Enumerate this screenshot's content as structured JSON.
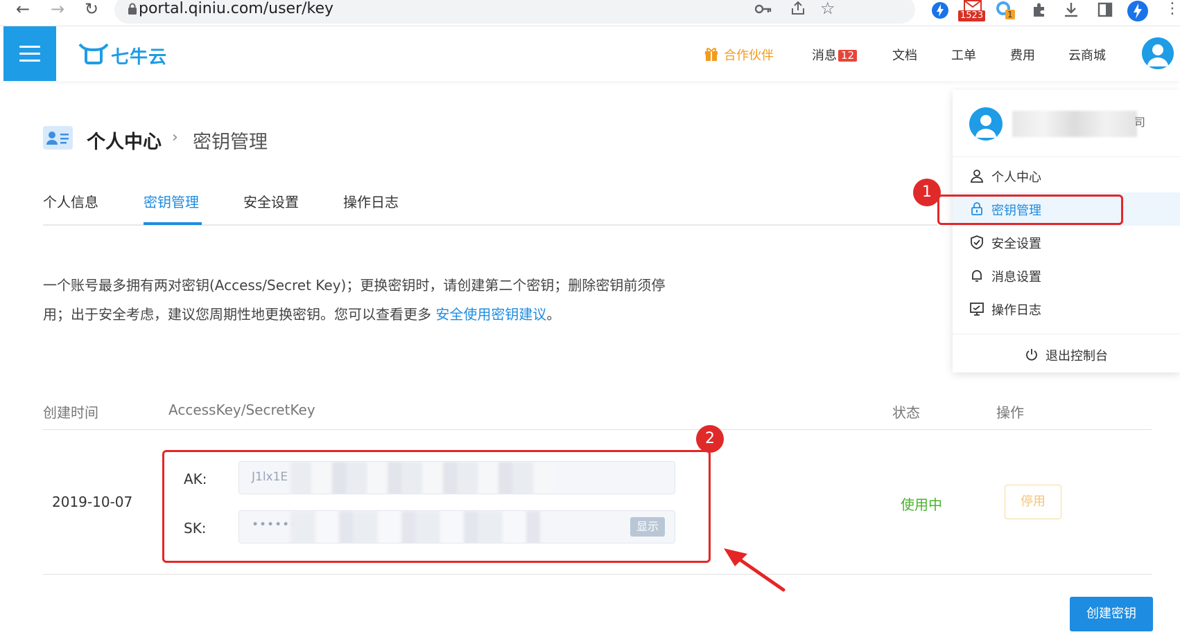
{
  "browser": {
    "url": "portal.qiniu.com/user/key",
    "mail_badge": "1523",
    "ext_badge": "1"
  },
  "header": {
    "brand": "七牛云",
    "nav": {
      "partner": "合作伙伴",
      "messages": "消息",
      "messages_count": "12",
      "docs": "文档",
      "tickets": "工单",
      "billing": "费用",
      "mall": "云商城"
    }
  },
  "page": {
    "breadcrumb_main": "个人中心",
    "breadcrumb_sep": "›",
    "breadcrumb_sub": "密钥管理",
    "tabs": [
      {
        "label": "个人信息"
      },
      {
        "label": "密钥管理"
      },
      {
        "label": "安全设置"
      },
      {
        "label": "操作日志"
      }
    ],
    "description_line1": "一个账号最多拥有两对密钥(Access/Secret Key)；更换密钥时，请创建第二个密钥；删除密钥前须停",
    "description_line2": "用；出于安全考虑，建议您周期性地更换密钥。您可以查看更多",
    "description_link": "安全使用密钥建议",
    "description_end": "。"
  },
  "table": {
    "headers": {
      "created": "创建时间",
      "keys": "AccessKey/SecretKey",
      "status": "状态",
      "actions": "操作"
    },
    "rows": [
      {
        "created": "2019-10-07",
        "ak_label": "AK:",
        "ak_value": "J1lx1E",
        "sk_label": "SK:",
        "sk_value": "••••••••",
        "show_label": "显示",
        "status": "使用中",
        "action": "停用"
      }
    ],
    "create_button": "创建密钥"
  },
  "dropdown": {
    "account_name_suffix": "司",
    "items": [
      {
        "label": "个人中心",
        "icon": "user-icon"
      },
      {
        "label": "密钥管理",
        "icon": "lock-icon"
      },
      {
        "label": "安全设置",
        "icon": "shield-icon"
      },
      {
        "label": "消息设置",
        "icon": "bell-icon"
      },
      {
        "label": "操作日志",
        "icon": "log-icon"
      }
    ],
    "logout": "退出控制台"
  },
  "annotations": {
    "step1": "1",
    "step2": "2"
  },
  "colors": {
    "primary": "#1e8ce0",
    "brand": "#1e9ce6",
    "partner": "#f29b1d",
    "status_ok": "#48b42c",
    "annotation_red": "#e42626"
  }
}
